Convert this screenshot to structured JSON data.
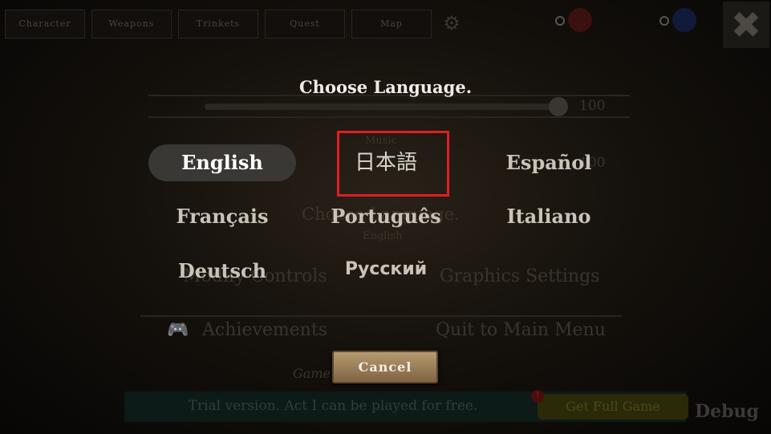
{
  "nav": {
    "tabs": [
      "Character",
      "Weapons",
      "Trinkets",
      "Quest",
      "Map"
    ],
    "settings_icon": "gear-icon",
    "close_icon": "close-icon"
  },
  "background": {
    "volume_value": "100",
    "music_label": "Music",
    "music_value": "100",
    "choose_language_label": "Choose Language.",
    "current_language": "English",
    "modify_controls": "Modify Controls",
    "graphics_settings": "Graphics Settings",
    "achievements": "Achievements",
    "quit_menu": "Quit to Main Menu",
    "note": "Game ... ically",
    "trial_text": "Trial version. Act I can be played for free.",
    "full_game_button": "Get Full Game",
    "badge": "!",
    "debug": "Debug"
  },
  "dialog": {
    "title": "Choose Language.",
    "languages": [
      {
        "label": "English",
        "selected": true
      },
      {
        "label": "日本語",
        "selected": false
      },
      {
        "label": "Español",
        "selected": false
      },
      {
        "label": "Français",
        "selected": false
      },
      {
        "label": "Português",
        "selected": false
      },
      {
        "label": "Italiano",
        "selected": false
      },
      {
        "label": "Deutsch",
        "selected": false
      },
      {
        "label": "Русский",
        "selected": false
      }
    ],
    "cancel_label": "Cancel"
  },
  "colors": {
    "highlight": "#e01d24",
    "selected_pill": "#3a3835",
    "cancel_button": "#a38860"
  }
}
